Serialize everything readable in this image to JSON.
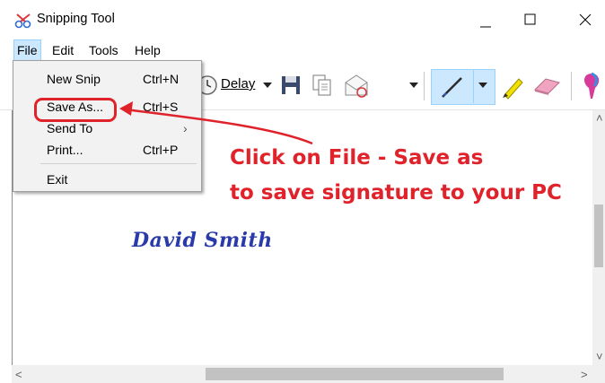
{
  "window": {
    "title": "Snipping Tool"
  },
  "menubar": {
    "items": [
      "File",
      "Edit",
      "Tools",
      "Help"
    ]
  },
  "toolbar": {
    "delay_label": "Delay"
  },
  "file_menu": {
    "items": [
      {
        "label": "New Snip",
        "shortcut": "Ctrl+N"
      },
      {
        "label": "Save As...",
        "shortcut": "Ctrl+S"
      },
      {
        "label": "Send To",
        "shortcut": ""
      },
      {
        "label": "Print...",
        "shortcut": "Ctrl+P"
      },
      {
        "label": "Exit",
        "shortcut": ""
      }
    ]
  },
  "canvas": {
    "signature": "David Smith",
    "annotation_line1": "Click on File - Save as",
    "annotation_line2": "to save signature to your PC"
  },
  "colors": {
    "annotation": "#e0222b",
    "signature": "#2a3aa8",
    "menu_highlight": "#cce8ff"
  }
}
